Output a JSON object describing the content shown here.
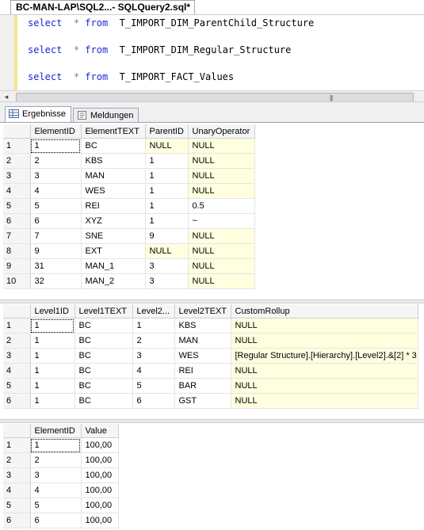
{
  "window": {
    "tab_title": "BC-MAN-LAP\\SQL2...- SQLQuery2.sql*"
  },
  "editor": {
    "lines": [
      {
        "kw1": "select",
        "op": "*",
        "kw2": "from",
        "table": "T_IMPORT_DIM_ParentChild_Structure"
      },
      {
        "kw1": "select",
        "op": "*",
        "kw2": "from",
        "table": "T_IMPORT_DIM_Regular_Structure"
      },
      {
        "kw1": "select",
        "op": "*",
        "kw2": "from",
        "table": "T_IMPORT_FACT_Values"
      }
    ],
    "scroll_left": "◂",
    "scroll_grip": "|||"
  },
  "tabs": {
    "results": "Ergebnisse",
    "messages": "Meldungen"
  },
  "colors": {
    "null_cell": "#ffffe0",
    "keyword": "#1a27d6"
  },
  "result_sets": [
    {
      "columns": [
        "ElementID",
        "ElementTEXT",
        "ParentID",
        "UnaryOperator"
      ],
      "rows": [
        [
          "1",
          "1",
          "BC",
          "NULL",
          "NULL"
        ],
        [
          "2",
          "2",
          "KBS",
          "1",
          "NULL"
        ],
        [
          "3",
          "3",
          "MAN",
          "1",
          "NULL"
        ],
        [
          "4",
          "4",
          "WES",
          "1",
          "NULL"
        ],
        [
          "5",
          "5",
          "REI",
          "1",
          "0.5"
        ],
        [
          "6",
          "6",
          "XYZ",
          "1",
          "~"
        ],
        [
          "7",
          "7",
          "SNE",
          "9",
          "NULL"
        ],
        [
          "8",
          "9",
          "EXT",
          "NULL",
          "NULL"
        ],
        [
          "9",
          "31",
          "MAN_1",
          "3",
          "NULL"
        ],
        [
          "10",
          "32",
          "MAN_2",
          "3",
          "NULL"
        ]
      ]
    },
    {
      "columns": [
        "Level1ID",
        "Level1TEXT",
        "Level2...",
        "Level2TEXT",
        "CustomRollup"
      ],
      "rows": [
        [
          "1",
          "1",
          "BC",
          "1",
          "KBS",
          "NULL"
        ],
        [
          "2",
          "1",
          "BC",
          "2",
          "MAN",
          "NULL"
        ],
        [
          "3",
          "1",
          "BC",
          "3",
          "WES",
          "[Regular Structure].[Hierarchy].[Level2].&[2] * 3"
        ],
        [
          "4",
          "1",
          "BC",
          "4",
          "REI",
          "NULL"
        ],
        [
          "5",
          "1",
          "BC",
          "5",
          "BAR",
          "NULL"
        ],
        [
          "6",
          "1",
          "BC",
          "6",
          "GST",
          "NULL"
        ]
      ]
    },
    {
      "columns": [
        "ElementID",
        "Value"
      ],
      "rows": [
        [
          "1",
          "1",
          "100,00"
        ],
        [
          "2",
          "2",
          "100,00"
        ],
        [
          "3",
          "3",
          "100,00"
        ],
        [
          "4",
          "4",
          "100,00"
        ],
        [
          "5",
          "5",
          "100,00"
        ],
        [
          "6",
          "6",
          "100,00"
        ]
      ]
    }
  ]
}
